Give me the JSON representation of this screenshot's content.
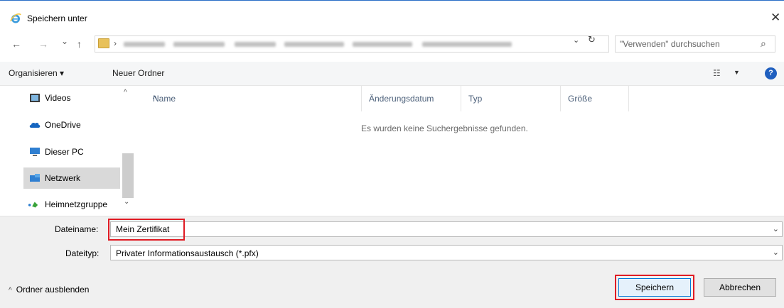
{
  "window": {
    "title": "Speichern unter",
    "close_glyph": "✕"
  },
  "address": {
    "back_glyph": "←",
    "forward_glyph": "→",
    "history_glyph": "⌄",
    "up_glyph": "↑",
    "separator": "›",
    "dropdown_glyph": "⌄",
    "refresh_glyph": "↻",
    "search_placeholder": "\"Verwenden\" durchsuchen",
    "search_glyph": "⌕"
  },
  "toolbar": {
    "organize_label": "Organisieren ▾",
    "new_folder_label": "Neuer Ordner",
    "view_glyph": "☷",
    "view_chev": "▼",
    "help_glyph": "?"
  },
  "nav": {
    "items": [
      {
        "label": "Videos",
        "icon": "video-icon"
      },
      {
        "label": "OneDrive",
        "icon": "cloud-icon"
      },
      {
        "label": "Dieser PC",
        "icon": "pc-icon"
      },
      {
        "label": "Netzwerk",
        "icon": "network-icon",
        "selected": true
      },
      {
        "label": "Heimnetzgruppe",
        "icon": "homegroup-icon"
      }
    ],
    "scroll_up": "^",
    "scroll_down": "⌄"
  },
  "list": {
    "columns": [
      "Name",
      "Änderungsdatum",
      "Typ",
      "Größe"
    ],
    "sort_glyph": "^",
    "empty_message": "Es wurden keine Suchergebnisse gefunden."
  },
  "form": {
    "filename_label": "Dateiname:",
    "filename_value": "Mein Zertifikat",
    "filetype_label": "Dateityp:",
    "filetype_value": "Privater Informationsaustausch (*.pfx)",
    "dd_glyph": "⌄"
  },
  "footer": {
    "collapse_caret": "^",
    "collapse_label": "Ordner ausblenden",
    "save_label": "Speichern",
    "cancel_label": "Abbrechen"
  },
  "colors": {
    "accent": "#0078d7",
    "highlight_red": "#e01b24",
    "nav_selected": "#d9d9d9",
    "help_blue": "#1f5fbf"
  }
}
